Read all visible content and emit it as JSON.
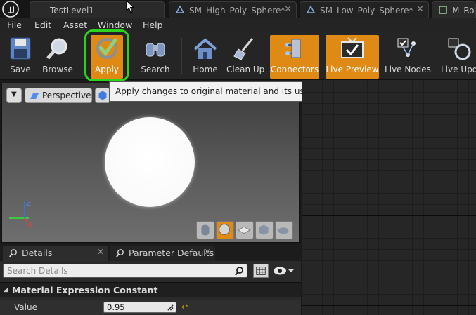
{
  "tabs": [
    {
      "label": "TestLevel1",
      "close": "✕"
    },
    {
      "label": "SM_High_Poly_Sphere*",
      "close": "✕"
    },
    {
      "label": "SM_Low_Poly_Sphere*",
      "close": "✕"
    },
    {
      "label": "M_Rou",
      "close": ""
    }
  ],
  "menu": [
    "File",
    "Edit",
    "Asset",
    "Window",
    "Help"
  ],
  "toolbar": {
    "save": "Save",
    "browse": "Browse",
    "apply": "Apply",
    "search": "Search",
    "home": "Home",
    "clean_up": "Clean Up",
    "connectors": "Connectors",
    "live_preview": "Live Preview",
    "live_nodes": "Live Nodes",
    "live_update": "Live Upda"
  },
  "tooltip": "Apply changes to original material and its use in the world.",
  "viewport": {
    "view_mode": "Perspective",
    "axis_z": "Z",
    "axis_x": "X",
    "dropdown_glyph": "▼"
  },
  "panel_tabs": {
    "details": "Details",
    "parameter_defaults": "Parameter Defaults",
    "close": "✕"
  },
  "details": {
    "search_placeholder": "Search Details",
    "section_arrow": "◢",
    "section_title": "Material Expression Constant",
    "property_name": "Value",
    "property_value": "0.95",
    "reset_glyph": "↩"
  },
  "colors": {
    "accent_orange": "#e08a16",
    "highlight_green": "#2bd51e"
  }
}
